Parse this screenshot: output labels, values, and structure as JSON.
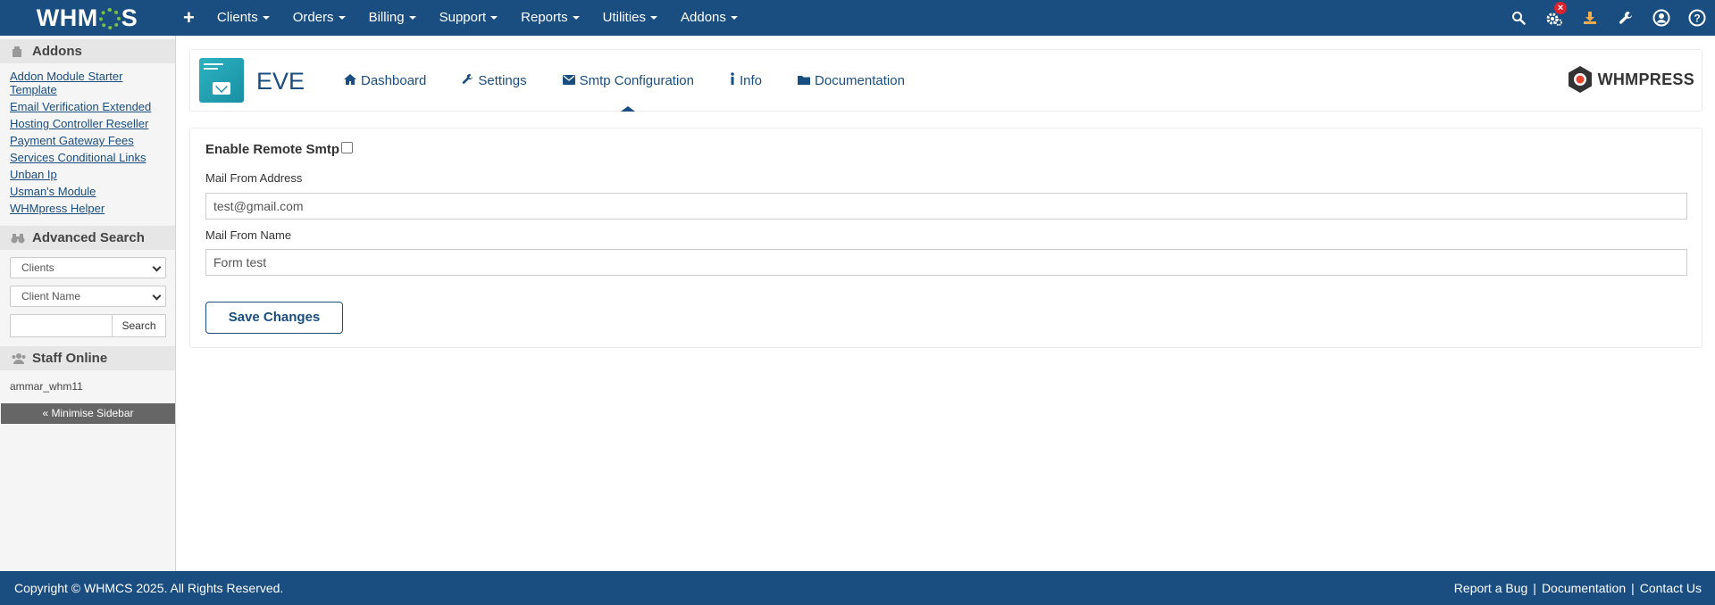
{
  "topbar": {
    "logo_text_left": "WHM",
    "logo_text_right": "S",
    "nav_items": [
      {
        "label": "Clients"
      },
      {
        "label": "Orders"
      },
      {
        "label": "Billing"
      },
      {
        "label": "Support"
      },
      {
        "label": "Reports"
      },
      {
        "label": "Utilities"
      },
      {
        "label": "Addons"
      }
    ],
    "icons": [
      "search-icon",
      "gear-icon",
      "download-icon",
      "wrench-icon",
      "user-icon",
      "help-icon"
    ],
    "notification_badge": "×"
  },
  "sidebar": {
    "addons_title": "Addons",
    "addon_links": [
      {
        "label": "Addon Module Starter Template"
      },
      {
        "label": "Email Verification Extended"
      },
      {
        "label": "Hosting Controller Reseller"
      },
      {
        "label": "Payment Gateway Fees"
      },
      {
        "label": "Services Conditional Links"
      },
      {
        "label": "Unban Ip"
      },
      {
        "label": "Usman's Module"
      },
      {
        "label": "WHMpress Helper"
      }
    ],
    "advanced_search_title": "Advanced Search",
    "search_type_selected": "Clients",
    "search_field_selected": "Client Name",
    "search_input_value": "",
    "search_button": "Search",
    "staff_online_title": "Staff Online",
    "staff_online_user": "ammar_whm11",
    "minimise_label": "« Minimise Sidebar"
  },
  "module": {
    "title": "EVE",
    "tabs": [
      {
        "label": "Dashboard",
        "icon": "home-icon"
      },
      {
        "label": "Settings",
        "icon": "wrench-icon"
      },
      {
        "label": "Smtp Configuration",
        "icon": "envelope-icon",
        "active": true
      },
      {
        "label": "Info",
        "icon": "info-icon"
      },
      {
        "label": "Documentation",
        "icon": "folder-icon"
      }
    ],
    "brand": "WHMPRESS"
  },
  "form": {
    "enable_label": "Enable Remote Smtp",
    "enable_checked": false,
    "mail_from_address_label": "Mail From Address",
    "mail_from_address_value": "test@gmail.com",
    "mail_from_name_label": "Mail From Name",
    "mail_from_name_value": "Form test",
    "save_button": "Save Changes"
  },
  "footer": {
    "copyright": "Copyright © WHMCS 2025. All Rights Reserved.",
    "links": [
      "Report a Bug",
      "Documentation",
      "Contact Us"
    ],
    "separator": "|"
  },
  "colors": {
    "primary": "#1a4d80",
    "sidebar_bg": "#f5f5f5",
    "accent_green": "#7ac143",
    "badge_red": "#d9232e"
  }
}
